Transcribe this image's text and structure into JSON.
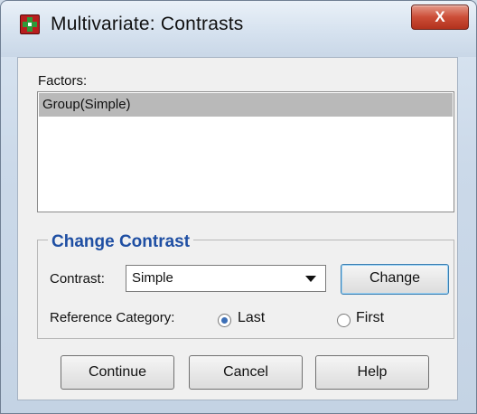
{
  "window": {
    "title": "Multivariate: Contrasts",
    "close_glyph": "X",
    "app_icon": "spss-app-icon"
  },
  "factors": {
    "label": "Factors:",
    "mnemonic_char": "F",
    "items": [
      "Group(Simple)"
    ],
    "selected_index": 0
  },
  "change_contrast": {
    "title": "Change Contrast",
    "contrast_label": "Contrast:",
    "contrast_value": "Simple",
    "change_button": "Change",
    "reference_label": "Reference Category:",
    "reference_options": [
      {
        "label": "Last",
        "checked": true
      },
      {
        "label": "First",
        "checked": false
      }
    ]
  },
  "buttons": {
    "continue": "Continue",
    "cancel": "Cancel",
    "help": "Help"
  },
  "colors": {
    "group_title": "#1f4fa3",
    "selection_bg": "#b9b9b9",
    "close_button": "#cc4d37",
    "radio_dot": "#3d6fb6"
  }
}
